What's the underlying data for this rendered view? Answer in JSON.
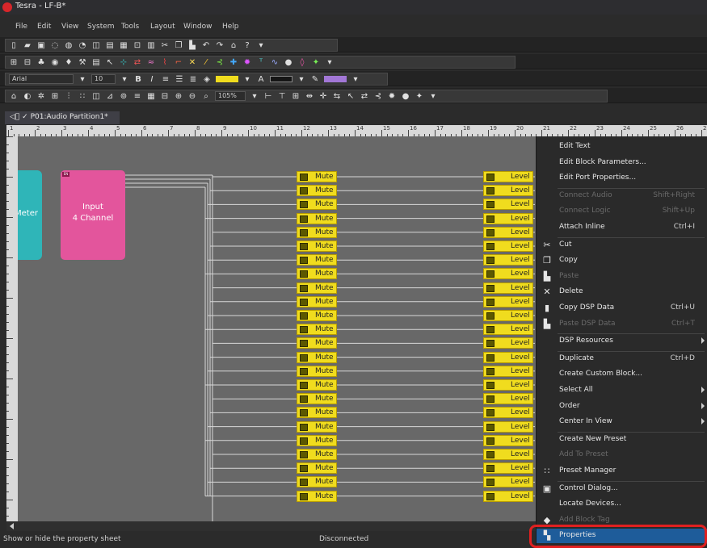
{
  "window": {
    "title": "Tesra - LF-B*"
  },
  "menubar": {
    "items": [
      "File",
      "Edit",
      "View",
      "System",
      "Tools",
      "Layout",
      "Window",
      "Help"
    ]
  },
  "formatting": {
    "font_name": "Arial",
    "font_size": "10",
    "bold": "B",
    "italic": "I",
    "text_color_glyph": "A",
    "fill_color": "#f0dc1e",
    "pen_color": "#a277d6"
  },
  "zoom": {
    "level": "105%"
  },
  "document": {
    "tab_label": "P01:Audio Partition1*"
  },
  "ruler": {
    "labels": [
      "1",
      "2",
      "3",
      "4",
      "5",
      "6",
      "7",
      "8",
      "9",
      "10",
      "11",
      "12",
      "13",
      "14",
      "15",
      "16",
      "17",
      "18",
      "19",
      "20",
      "21",
      "22",
      "23",
      "24",
      "25",
      "26",
      "27",
      "28"
    ]
  },
  "blocks": {
    "meter": {
      "label": "Meter",
      "color": "#2fb5b8"
    },
    "input": {
      "enable_badge": "EN",
      "line1": "Input",
      "line2": "4 Channel",
      "color": "#e3559c"
    },
    "mute_label": "Mute",
    "level_label": "Level",
    "channel_count": 24,
    "block_color": "#f0dc1e"
  },
  "context_menu": {
    "items": [
      {
        "label": "Edit Text",
        "shortcut": "",
        "disabled": false,
        "submenu": false,
        "icon": ""
      },
      {
        "label": "Edit Block Parameters...",
        "shortcut": "",
        "disabled": false,
        "submenu": false,
        "icon": ""
      },
      {
        "label": "Edit Port Properties...",
        "shortcut": "",
        "disabled": false,
        "submenu": false,
        "icon": ""
      },
      {
        "label": "Connect Audio",
        "shortcut": "Shift+Right",
        "disabled": true,
        "submenu": false,
        "icon": ""
      },
      {
        "label": "Connect Logic",
        "shortcut": "Shift+Up",
        "disabled": true,
        "submenu": false,
        "icon": ""
      },
      {
        "label": "Attach Inline",
        "shortcut": "Ctrl+I",
        "disabled": false,
        "submenu": false,
        "icon": ""
      },
      {
        "label": "Cut",
        "shortcut": "",
        "disabled": false,
        "submenu": false,
        "icon": "scissors-icon"
      },
      {
        "label": "Copy",
        "shortcut": "",
        "disabled": false,
        "submenu": false,
        "icon": "copy-icon"
      },
      {
        "label": "Paste",
        "shortcut": "",
        "disabled": true,
        "submenu": false,
        "icon": "paste-icon"
      },
      {
        "label": "Delete",
        "shortcut": "",
        "disabled": false,
        "submenu": false,
        "icon": "delete-icon"
      },
      {
        "label": "Copy DSP Data",
        "shortcut": "Ctrl+U",
        "disabled": false,
        "submenu": false,
        "icon": "copy-dsp-icon"
      },
      {
        "label": "Paste DSP Data",
        "shortcut": "Ctrl+T",
        "disabled": true,
        "submenu": false,
        "icon": "paste-dsp-icon"
      },
      {
        "label": "DSP Resources",
        "shortcut": "",
        "disabled": false,
        "submenu": true,
        "icon": ""
      },
      {
        "label": "Duplicate",
        "shortcut": "Ctrl+D",
        "disabled": false,
        "submenu": false,
        "icon": ""
      },
      {
        "label": "Create Custom Block...",
        "shortcut": "",
        "disabled": false,
        "submenu": false,
        "icon": ""
      },
      {
        "label": "Select All",
        "shortcut": "",
        "disabled": false,
        "submenu": true,
        "icon": ""
      },
      {
        "label": "Order",
        "shortcut": "",
        "disabled": false,
        "submenu": true,
        "icon": ""
      },
      {
        "label": "Center In View",
        "shortcut": "",
        "disabled": false,
        "submenu": true,
        "icon": ""
      },
      {
        "label": "Create New Preset",
        "shortcut": "",
        "disabled": false,
        "submenu": false,
        "icon": ""
      },
      {
        "label": "Add To Preset",
        "shortcut": "",
        "disabled": true,
        "submenu": false,
        "icon": ""
      },
      {
        "label": "Preset Manager",
        "shortcut": "",
        "disabled": false,
        "submenu": false,
        "icon": "preset-manager-icon"
      },
      {
        "label": "Control Dialog...",
        "shortcut": "",
        "disabled": false,
        "submenu": false,
        "icon": "control-dialog-icon"
      },
      {
        "label": "Locate Devices...",
        "shortcut": "",
        "disabled": false,
        "submenu": false,
        "icon": ""
      },
      {
        "label": "Add Block Tag",
        "shortcut": "",
        "disabled": true,
        "submenu": false,
        "icon": "tag-icon"
      },
      {
        "label": "Properties",
        "shortcut": "",
        "disabled": false,
        "submenu": false,
        "icon": "properties-icon",
        "highlighted": true
      }
    ]
  },
  "statusbar": {
    "hint": "Show or hide the property sheet",
    "connection": "Disconnected"
  },
  "annotation": {
    "ring_color": "#e02020"
  }
}
